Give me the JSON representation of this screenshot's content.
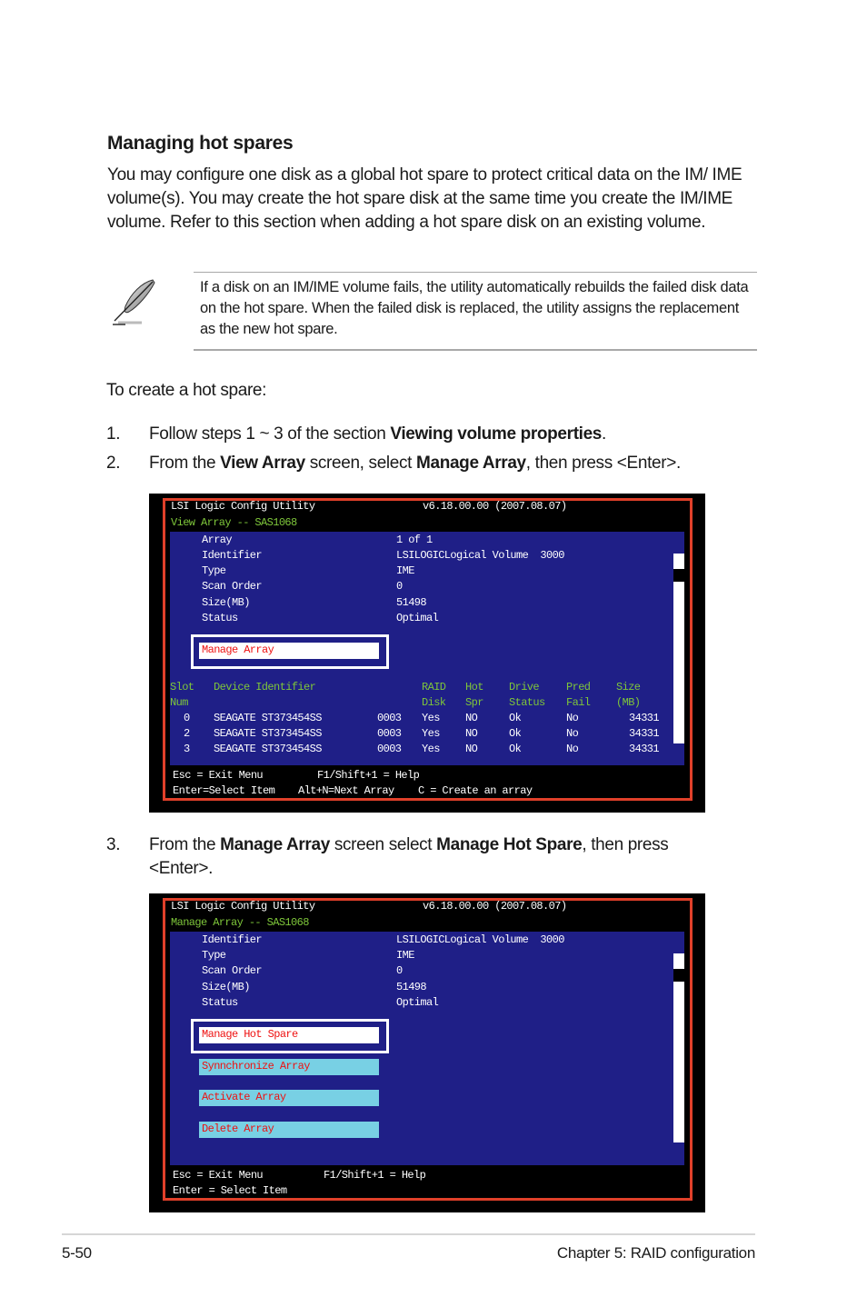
{
  "section": {
    "heading": "Managing hot spares",
    "paragraph": "You may configure one disk as a global hot spare to protect critical data on the IM/ IME volume(s). You may create the hot spare disk at the same time you create the IM/IME volume. Refer to this section when adding a hot spare disk on an existing volume."
  },
  "note": {
    "icon": "feather-pen-icon",
    "text": "If a disk on an IM/IME volume fails, the utility automatically rebuilds the failed disk data on the hot spare. When the failed disk is replaced, the utility assigns the replacement as the new hot spare."
  },
  "intro": "To create a hot spare:",
  "steps": [
    {
      "num": "1.",
      "parts": [
        {
          "t": "Follow steps 1 ~ 3 of the section "
        },
        {
          "b": "Viewing volume properties"
        },
        {
          "t": "."
        }
      ]
    },
    {
      "num": "2.",
      "parts": [
        {
          "t": "From the "
        },
        {
          "b": "View Array"
        },
        {
          "t": " screen, select "
        },
        {
          "b": "Manage Array"
        },
        {
          "t": ", then press <Enter>."
        }
      ]
    },
    {
      "num": "3.",
      "parts": [
        {
          "t": "From the "
        },
        {
          "b": "Manage Array"
        },
        {
          "t": " screen select "
        },
        {
          "b": "Manage Hot Spare"
        },
        {
          "t": ", then press <Enter>."
        }
      ]
    }
  ],
  "screen1": {
    "app_title": "LSI Logic Config Utility",
    "version": "v6.18.00.00 (2007.08.07)",
    "subtitle": "View Array -- SAS1068",
    "props": [
      {
        "label": "Array",
        "value": "1 of 1"
      },
      {
        "label": "Identifier",
        "value": "LSILOGICLogical Volume  3000"
      },
      {
        "label": "Type",
        "value": "IME"
      },
      {
        "label": "Scan Order",
        "value": "0"
      },
      {
        "label": "Size(MB)",
        "value": "51498"
      },
      {
        "label": "Status",
        "value": "Optimal"
      }
    ],
    "selected_item": "Manage Array",
    "table_headers": {
      "row1": [
        "Slot",
        "Device Identifier",
        "RAID",
        "Hot",
        "Drive",
        "Pred",
        "Size"
      ],
      "row2": [
        "Num",
        "",
        "Disk",
        "Spr",
        "Status",
        "Fail",
        "(MB)"
      ]
    },
    "rows": [
      {
        "slot": "0",
        "device": "SEAGATE ST373454SS",
        "rev": "0003",
        "raid": "Yes",
        "hot": "NO",
        "status": "Ok",
        "pred": "No",
        "size": "34331"
      },
      {
        "slot": "2",
        "device": "SEAGATE ST373454SS",
        "rev": "0003",
        "raid": "Yes",
        "hot": "NO",
        "status": "Ok",
        "pred": "No",
        "size": "34331"
      },
      {
        "slot": "3",
        "device": "SEAGATE ST373454SS",
        "rev": "0003",
        "raid": "Yes",
        "hot": "NO",
        "status": "Ok",
        "pred": "No",
        "size": "34331"
      }
    ],
    "footer": {
      "line1a": "Esc = Exit Menu",
      "line1b": "F1/Shift+1 = Help",
      "line2a": "Enter=Select Item",
      "line2b": "Alt+N=Next Array",
      "line2c": "C = Create an array"
    }
  },
  "screen2": {
    "app_title": "LSI Logic Config Utility",
    "version": "v6.18.00.00 (2007.08.07)",
    "subtitle": "Manage Array -- SAS1068",
    "props": [
      {
        "label": "Identifier",
        "value": "LSILOGICLogical Volume  3000"
      },
      {
        "label": "Type",
        "value": "IME"
      },
      {
        "label": "Scan Order",
        "value": "0"
      },
      {
        "label": "Size(MB)",
        "value": "51498"
      },
      {
        "label": "Status",
        "value": "Optimal"
      }
    ],
    "selected_item": "Manage Hot Spare",
    "menu_items": [
      "Synnchronize Array",
      "Activate Array",
      "Delete Array"
    ],
    "footer": {
      "line1a": "Esc = Exit Menu",
      "line1b": "F1/Shift+1 = Help",
      "line2a": "Enter = Select Item"
    }
  },
  "page_footer": {
    "page_number": "5-50",
    "chapter": "Chapter 5: RAID configuration"
  },
  "colors": {
    "terminal_bg": "#000000",
    "frame_red": "#e0402a",
    "panel_blue": "#1f1f87",
    "subtitle_green": "#7ec63a",
    "menu_cyan": "#78d0e4",
    "menu_text_red": "#ee1111"
  }
}
